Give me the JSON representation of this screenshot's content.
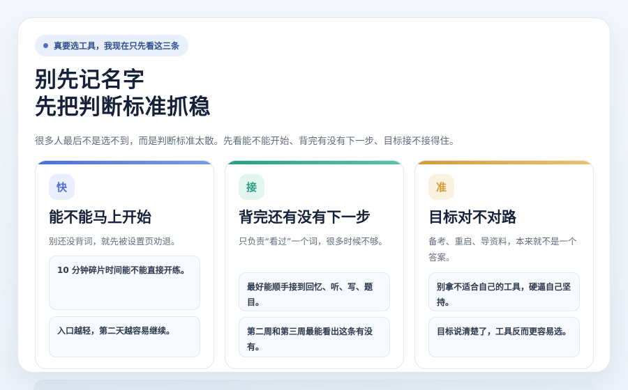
{
  "header": {
    "pill": "真要选工具，我现在只先看这三条",
    "title_line1": "别先记名字",
    "title_line2": "先把判断标准抓稳",
    "subtitle": "很多人最后不是选不到，而是判断标准太散。先看能不能开始、背完有没有下一步、目标接不接得住。"
  },
  "cards": [
    {
      "badge": "快",
      "title": "能不能马上开始",
      "desc": "别还没背词，就先被设置页劝退。",
      "notes": [
        "10 分钟碎片时间能不能直接开练。",
        "入口越轻，第二天越容易继续。"
      ]
    },
    {
      "badge": "接",
      "title": "背完还有没有下一步",
      "desc": "只负责“看过”一个词，很多时候不够。",
      "notes": [
        "最好能顺手接到回忆、听、写、题目。",
        "第二周和第三周最能看出这条有没有。"
      ]
    },
    {
      "badge": "准",
      "title": "目标对不对路",
      "desc": "备考、重启、导资料，本来就不是一个答案。",
      "notes": [
        "别拿不适合自己的工具，硬逼自己坚持。",
        "目标说清楚了，工具反而更容易选。"
      ]
    }
  ],
  "colors": {
    "card1_accent": "#4a6fd6",
    "card2_accent": "#2a9d82",
    "card3_accent": "#d49a35"
  }
}
